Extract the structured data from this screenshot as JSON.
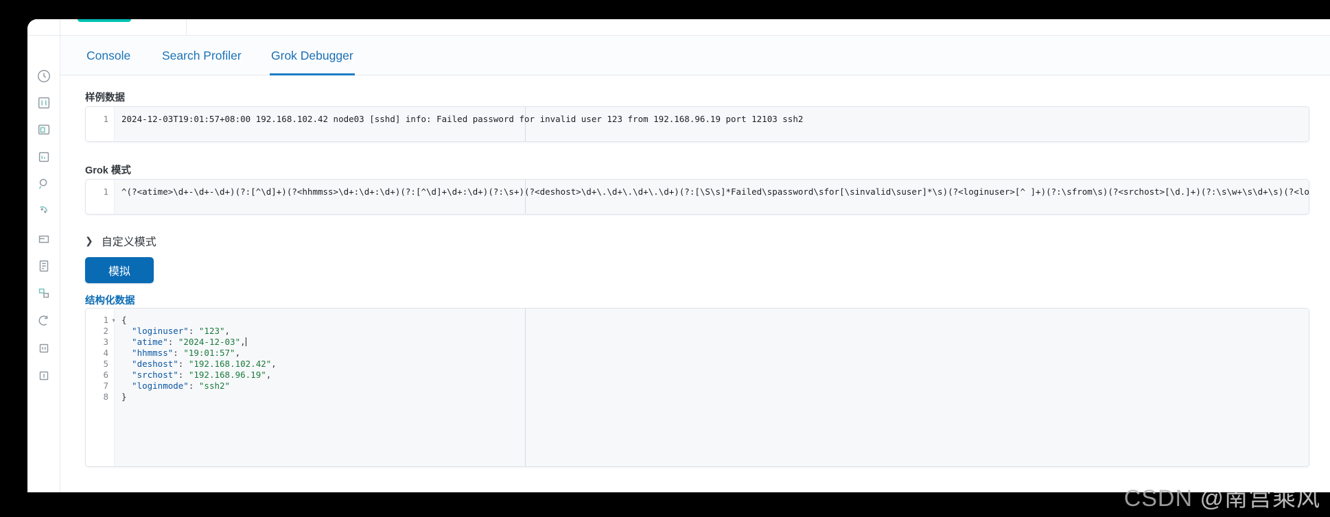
{
  "tabs": [
    {
      "id": "console",
      "label": "Console",
      "selected": false
    },
    {
      "id": "search-profiler",
      "label": "Search Profiler",
      "selected": false
    },
    {
      "id": "grok-debugger",
      "label": "Grok Debugger",
      "selected": true
    }
  ],
  "sample_data": {
    "label": "样例数据",
    "line_number": "1",
    "content": "2024-12-03T19:01:57+08:00 192.168.102.42 node03 [sshd] info: Failed password for invalid user 123 from 192.168.96.19 port 12103 ssh2"
  },
  "grok_pattern": {
    "label": "Grok 模式",
    "line_number": "1",
    "content": "^(?<atime>\\d+-\\d+-\\d+)(?:[^\\d]+)(?<hhmmss>\\d+:\\d+:\\d+)(?:[^\\d]+\\d+:\\d+)(?:\\s+)(?<deshost>\\d+\\.\\d+\\.\\d+\\.\\d+)(?:[\\S\\s]*Failed\\spassword\\sfor[\\sinvalid\\suser]*\\s)(?<loginuser>[^ ]+)(?:\\sfrom\\s)(?<srchost>[\\d.]+)(?:\\s\\w+\\s\\d+\\s)(?<loginmode>\\w*)"
  },
  "custom_patterns": {
    "label": "自定义模式",
    "expanded": false,
    "chevron": "chevron-right-icon"
  },
  "simulate_button": {
    "label": "模拟"
  },
  "structured_data": {
    "label": "结构化数据",
    "lines": [
      {
        "num": "1",
        "foldable": true,
        "tokens": [
          {
            "t": "punct",
            "v": "{"
          }
        ]
      },
      {
        "num": "2",
        "foldable": false,
        "tokens": [
          {
            "t": "key",
            "v": "  \"loginuser\""
          },
          {
            "t": "punct",
            "v": ": "
          },
          {
            "t": "str",
            "v": "\"123\""
          },
          {
            "t": "punct",
            "v": ","
          }
        ]
      },
      {
        "num": "3",
        "foldable": false,
        "tokens": [
          {
            "t": "key",
            "v": "  \"atime\""
          },
          {
            "t": "punct",
            "v": ": "
          },
          {
            "t": "str",
            "v": "\"2024-12-03\""
          },
          {
            "t": "punct",
            "v": ","
          }
        ],
        "caret": true
      },
      {
        "num": "4",
        "foldable": false,
        "tokens": [
          {
            "t": "key",
            "v": "  \"hhmmss\""
          },
          {
            "t": "punct",
            "v": ": "
          },
          {
            "t": "str",
            "v": "\"19:01:57\""
          },
          {
            "t": "punct",
            "v": ","
          }
        ]
      },
      {
        "num": "5",
        "foldable": false,
        "tokens": [
          {
            "t": "key",
            "v": "  \"deshost\""
          },
          {
            "t": "punct",
            "v": ": "
          },
          {
            "t": "str",
            "v": "\"192.168.102.42\""
          },
          {
            "t": "punct",
            "v": ","
          }
        ]
      },
      {
        "num": "6",
        "foldable": false,
        "tokens": [
          {
            "t": "key",
            "v": "  \"srchost\""
          },
          {
            "t": "punct",
            "v": ": "
          },
          {
            "t": "str",
            "v": "\"192.168.96.19\""
          },
          {
            "t": "punct",
            "v": ","
          }
        ]
      },
      {
        "num": "7",
        "foldable": false,
        "tokens": [
          {
            "t": "key",
            "v": "  \"loginmode\""
          },
          {
            "t": "punct",
            "v": ": "
          },
          {
            "t": "str",
            "v": "\"ssh2\""
          }
        ]
      },
      {
        "num": "8",
        "foldable": false,
        "tokens": [
          {
            "t": "punct",
            "v": "}"
          }
        ]
      }
    ]
  },
  "sidebar": {
    "items": [
      {
        "name": "recently-viewed-icon"
      },
      {
        "name": "dashboard-icon"
      },
      {
        "name": "discover-icon"
      },
      {
        "name": "visualize-icon"
      },
      {
        "name": "canvas-icon"
      },
      {
        "name": "maps-icon"
      },
      {
        "name": "machine-learning-icon"
      },
      {
        "name": "logs-icon"
      },
      {
        "name": "metrics-icon"
      },
      {
        "name": "uptime-icon"
      },
      {
        "name": "apm-icon"
      },
      {
        "name": "management-icon"
      }
    ]
  },
  "watermark": {
    "prefix": "CSDN ",
    "handle": "@南宫乘风"
  },
  "colors": {
    "accent_blue": "#0a6bb5",
    "tab_blue": "#1a73b7",
    "teal": "#00bfb3",
    "json_key": "#0b57a4",
    "json_string": "#1a7a3c"
  }
}
